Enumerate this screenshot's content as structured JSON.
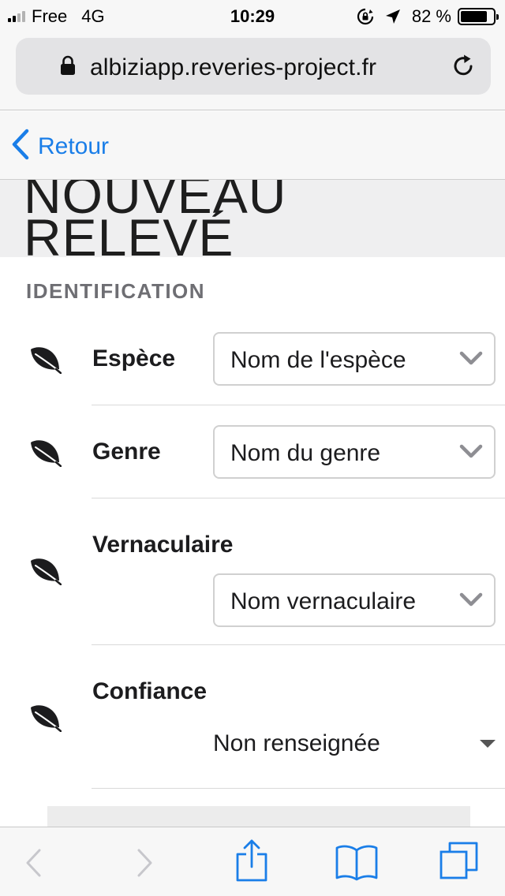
{
  "status_bar": {
    "carrier": "Free",
    "network": "4G",
    "time": "10:29",
    "battery_text": "82 %",
    "battery_level": 0.82
  },
  "browser": {
    "url": "albiziapp.reveries-project.fr"
  },
  "nav": {
    "back_label": "Retour"
  },
  "page": {
    "title": "NOUVEAU RELEVÉ",
    "section_title": "IDENTIFICATION"
  },
  "form": {
    "espece": {
      "label": "Espèce",
      "value": "Nom de l'espèce"
    },
    "genre": {
      "label": "Genre",
      "value": "Nom du genre"
    },
    "vernaculaire": {
      "label": "Vernaculaire",
      "value": "Nom vernaculaire"
    },
    "confiance": {
      "label": "Confiance",
      "value": "Non renseignée"
    }
  },
  "colors": {
    "accent": "#1a7ee8",
    "text": "#1c1c1e",
    "section": "#6e6e73"
  },
  "icons": {
    "row": "leaf-icon",
    "toolbar": [
      "back-arrow-icon",
      "forward-arrow-icon",
      "share-icon",
      "bookmarks-icon",
      "tabs-icon"
    ]
  }
}
